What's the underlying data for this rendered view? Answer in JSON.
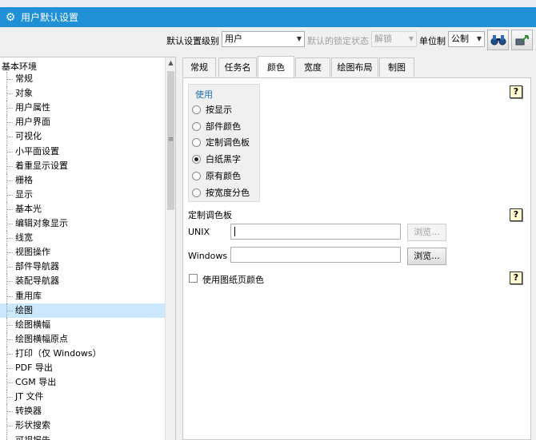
{
  "window": {
    "title": "用户默认设置"
  },
  "toolbar": {
    "level_label": "默认设置级别",
    "level_value": "用户",
    "lock_label": "默认的锁定状态",
    "lock_value": "解锁",
    "unit_label": "单位制",
    "unit_value": "公制"
  },
  "tree": {
    "root": "基本环境",
    "items": [
      "常规",
      "对象",
      "用户属性",
      "用户界面",
      "可视化",
      "小平面设置",
      "着重显示设置",
      "栅格",
      "显示",
      "基本光",
      "编辑对象显示",
      "线宽",
      "视图操作",
      "部件导航器",
      "装配导航器",
      "重用库",
      "绘图",
      "绘图横幅",
      "绘图横幅原点",
      "打印（仅 Windows）",
      "PDF 导出",
      "CGM 导出",
      "JT 文件",
      "转换器",
      "形状搜索",
      "可视报告"
    ],
    "selected": "绘图"
  },
  "tabs": [
    "常规",
    "任务名",
    "颜色",
    "宽度",
    "绘图布局",
    "制图"
  ],
  "active_tab": "颜色",
  "color_panel": {
    "use_group": {
      "title": "使用",
      "options": [
        "按显示",
        "部件颜色",
        "定制调色板",
        "白纸黑字",
        "原有颜色",
        "按宽度分色"
      ],
      "selected": "白纸黑字"
    },
    "palette_title": "定制调色板",
    "unix_label": "UNIX",
    "unix_value": "",
    "windows_label": "Windows",
    "windows_value": "",
    "browse_label": "浏览...",
    "use_sheet_color_label": "使用图纸页颜色",
    "use_sheet_color_checked": false,
    "help_symbol": "?"
  },
  "colors": {
    "titlebar": "#1f8fd6",
    "selection": "#cce8ff",
    "group_title": "#1f6fb8"
  }
}
